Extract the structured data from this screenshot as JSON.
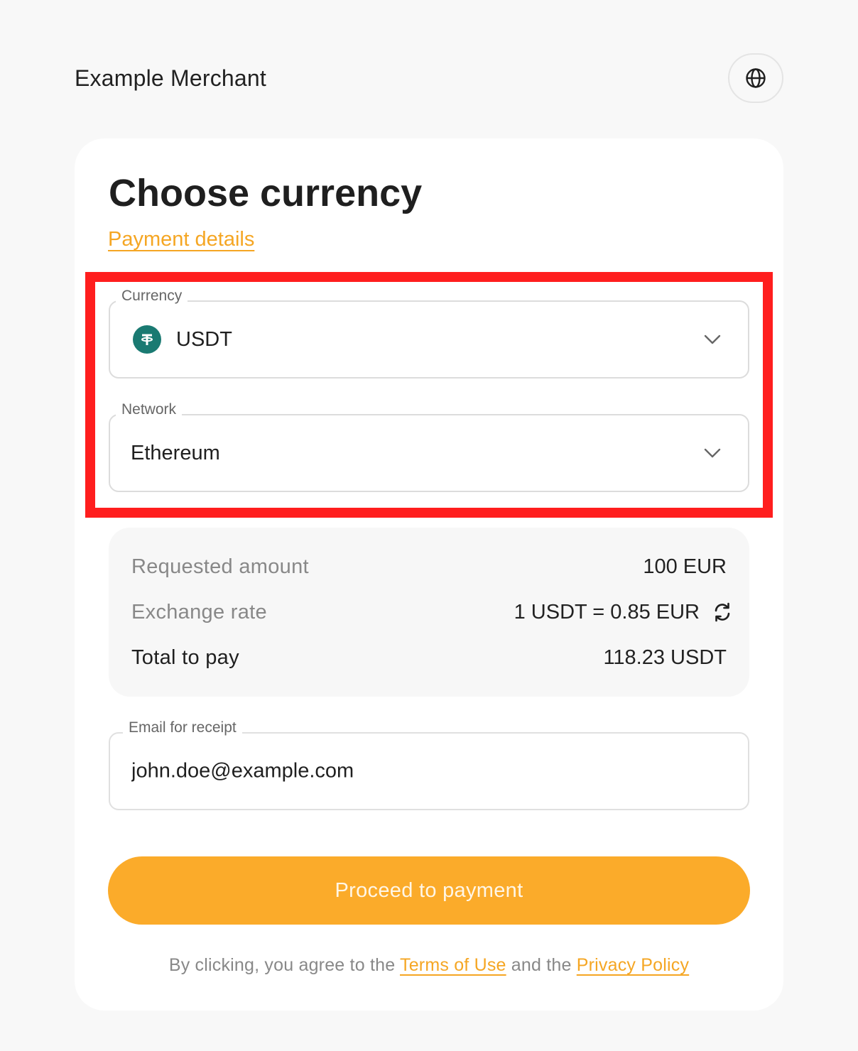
{
  "header": {
    "merchant_name": "Example Merchant",
    "language_icon": "globe-icon"
  },
  "card": {
    "title": "Choose currency",
    "details_link": "Payment details"
  },
  "currency_field": {
    "label": "Currency",
    "value": "USDT",
    "icon": "tether-coin-icon",
    "icon_color": "#1a7a72"
  },
  "network_field": {
    "label": "Network",
    "value": "Ethereum"
  },
  "summary": {
    "requested_label": "Requested amount",
    "requested_value": "100 EUR",
    "rate_label": "Exchange rate",
    "rate_value": "1 USDT = 0.85 EUR",
    "total_label": "Total to pay",
    "total_value": "118.23 USDT"
  },
  "email_field": {
    "label": "Email for receipt",
    "value": "john.doe@example.com"
  },
  "proceed_button": {
    "label": "Proceed to payment",
    "color": "#fbab2a"
  },
  "legal": {
    "prefix": "By clicking, you agree to the ",
    "terms_link": "Terms of Use",
    "middle": " and the ",
    "privacy_link": "Privacy Policy"
  },
  "colors": {
    "accent": "#f5a623",
    "highlight": "#ff1e1e"
  }
}
